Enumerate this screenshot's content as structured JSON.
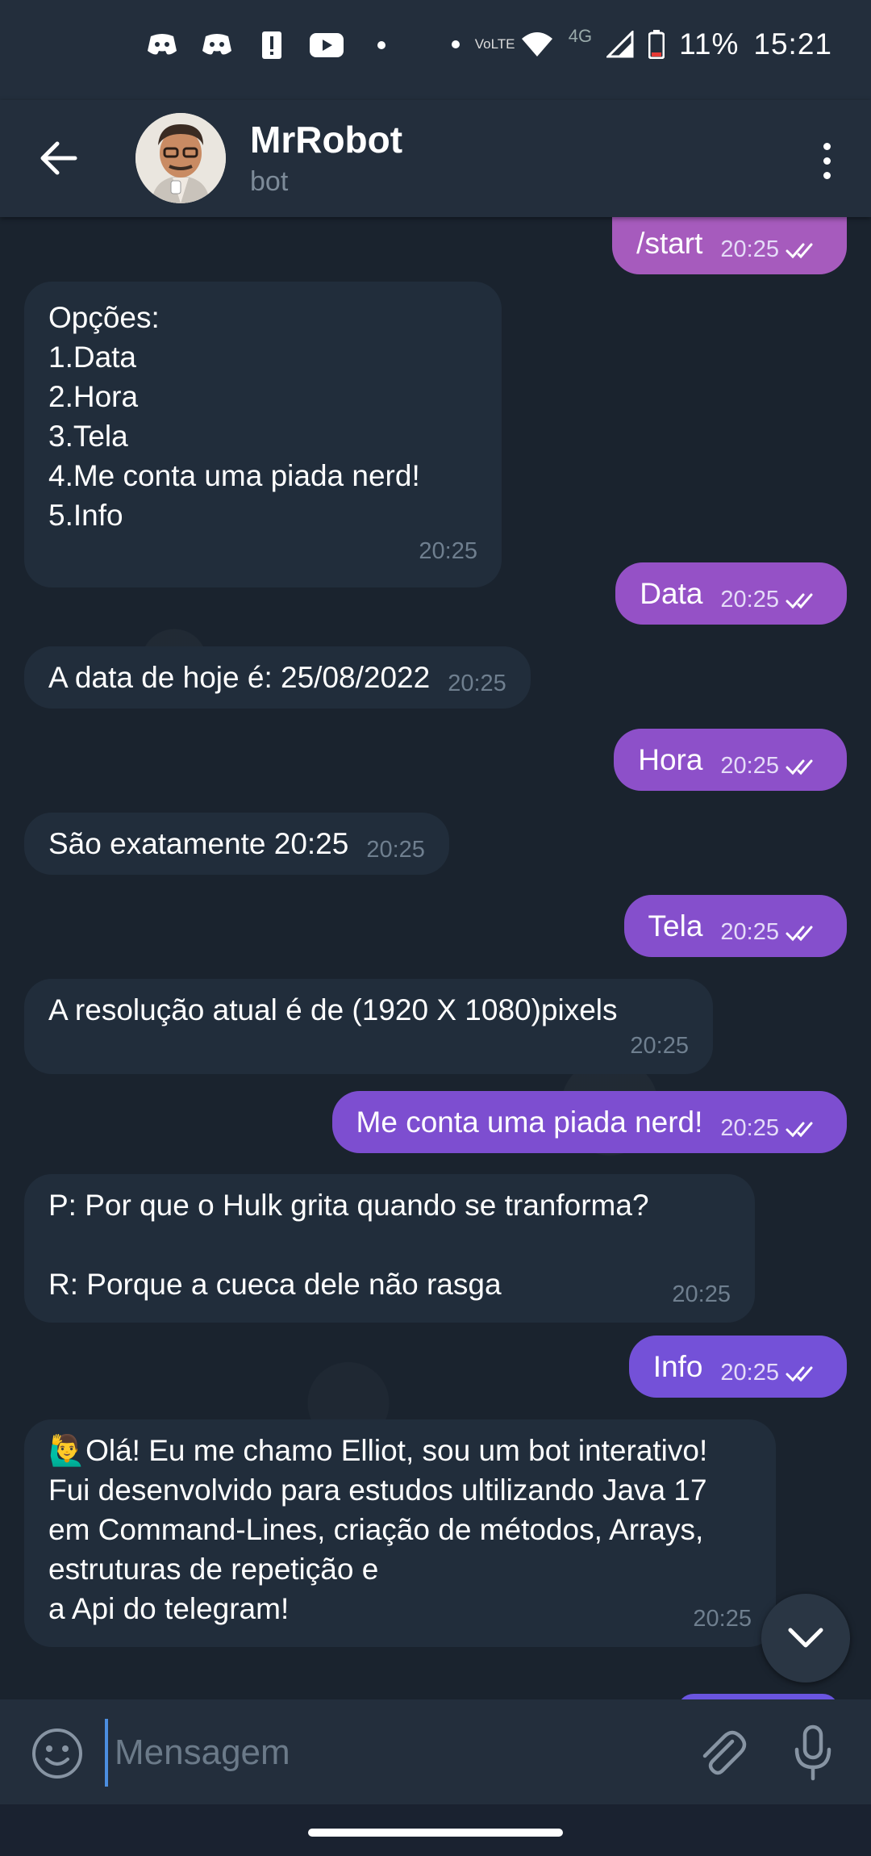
{
  "status_bar": {
    "battery": "11%",
    "time": "15:21",
    "network": "4G",
    "volte": "VoLTE"
  },
  "header": {
    "title": "MrRobot",
    "subtitle": "bot"
  },
  "messages": [
    {
      "dir": "out",
      "text": "/start",
      "time": "20:25"
    },
    {
      "dir": "in",
      "text": "Opções:\n1.Data\n2.Hora\n3.Tela\n4.Me conta uma piada nerd!\n5.Info",
      "time": "20:25"
    },
    {
      "dir": "out",
      "text": "Data",
      "time": "20:25"
    },
    {
      "dir": "in",
      "text": "A data de hoje é: 25/08/2022",
      "time": "20:25"
    },
    {
      "dir": "out",
      "text": "Hora",
      "time": "20:25"
    },
    {
      "dir": "in",
      "text": "São exatamente 20:25",
      "time": "20:25"
    },
    {
      "dir": "out",
      "text": "Tela",
      "time": "20:25"
    },
    {
      "dir": "in",
      "text": "A resolução atual é de (1920 X 1080)pixels",
      "time": "20:25"
    },
    {
      "dir": "out",
      "text": "Me conta uma piada nerd!",
      "time": "20:25"
    },
    {
      "dir": "in",
      "text": "P: Por que o Hulk grita quando se tranforma?\n\nR: Porque a cueca dele não rasga",
      "time": "20:25"
    },
    {
      "dir": "out",
      "text": "Info",
      "time": "20:25"
    },
    {
      "dir": "in",
      "text": "🙋‍♂️Olá! Eu me chamo Elliot, sou um bot interativo!\nFui desenvolvido para estudos ultilizando Java 17 em Command-Lines, criação de métodos, Arrays, estruturas de repetição e\na Api do telegram!",
      "time": "20:25"
    }
  ],
  "input": {
    "placeholder": "Mensagem"
  },
  "colors": {
    "outgoing_bubble": "#7b4fd1",
    "incoming_bubble": "#212d3b",
    "background": "#1a232e"
  }
}
